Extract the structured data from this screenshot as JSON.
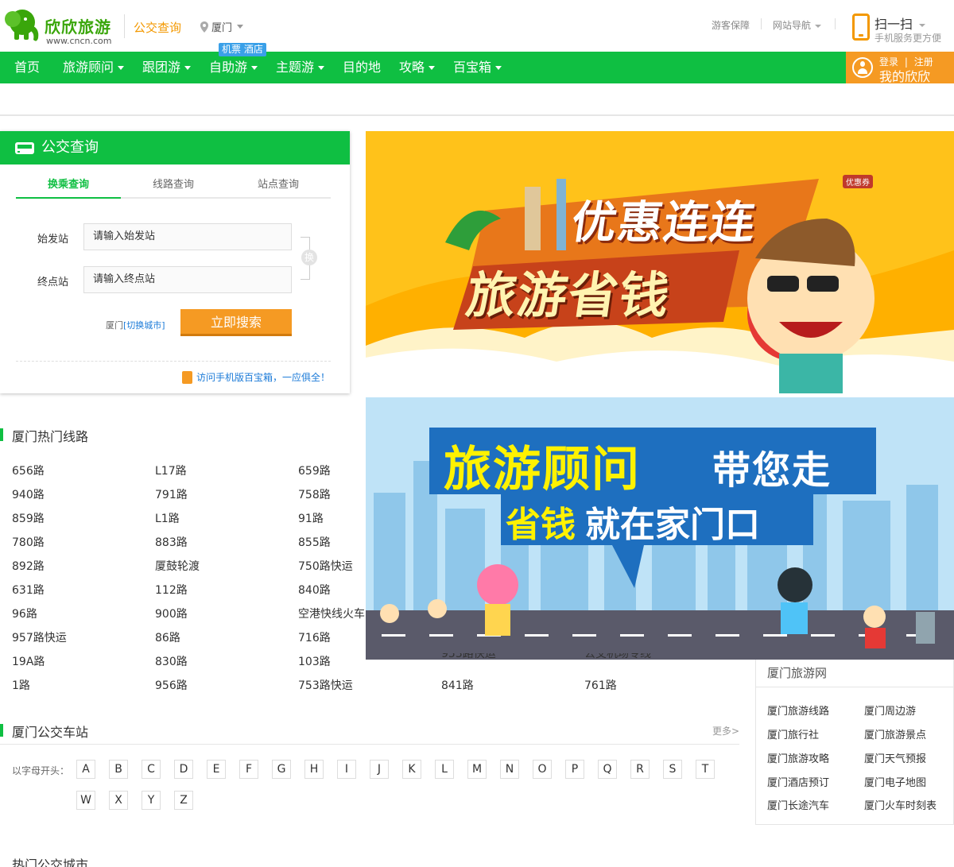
{
  "header": {
    "logo_text": "欣欣旅游",
    "logo_url": "www.cncn.com",
    "page_kind": "公交查询",
    "city": "厦门",
    "links": [
      "游客保障",
      "网站导航"
    ],
    "scan_title": "扫一扫",
    "scan_sub": "手机服务更方便"
  },
  "nav": {
    "items": [
      "首页",
      "旅游顾问",
      "跟团游",
      "自助游",
      "主题游",
      "目的地",
      "攻略",
      "百宝箱"
    ],
    "badge": "机票 酒店",
    "login": "登录",
    "register": "注册",
    "user_label": "我的欣欣"
  },
  "bus_panel": {
    "title": "公交查询",
    "tabs": [
      "换乘查询",
      "线路查询",
      "站点查询"
    ],
    "start_label": "始发站",
    "start_placeholder": "请输入始发站",
    "end_label": "终点站",
    "end_placeholder": "请输入终点站",
    "swap_label": "换",
    "city": "厦门",
    "switch_city": "[切换城市]",
    "search_button": "立即搜索",
    "mobile_note": "访问手机版百宝箱，一应俱全！"
  },
  "banner1": {
    "line1": "优惠连连",
    "line2": "旅游省钱",
    "tag": "优惠券"
  },
  "banner2": {
    "line1_a": "旅游顾问",
    "line1_b": "带您走",
    "line2_a": "省钱",
    "line2_b": "就在家门口"
  },
  "hot_routes": {
    "title": "厦门热门线路",
    "columns": [
      [
        "656路",
        "940路",
        "859路",
        "780路",
        "892路",
        "631路",
        "96路",
        "957路快运",
        "19A路",
        "1路"
      ],
      [
        "L17路",
        "791路",
        "L1路",
        "883路",
        "厦鼓轮渡",
        "112路",
        "900路",
        "86路",
        "830路",
        "956路"
      ],
      [
        "659路",
        "758路",
        "91路",
        "855路",
        "750路快运",
        "840路",
        "空港快线火车",
        "716路",
        "103路",
        "753路快运"
      ],
      [
        "953路快运",
        "841路"
      ],
      [
        "公交机场专线",
        "761路"
      ]
    ]
  },
  "stations": {
    "title": "厦门公交车站",
    "more": "更多>",
    "letters_label": "以字母开头：",
    "letters_row1": [
      "A",
      "B",
      "C",
      "D",
      "E",
      "F",
      "G",
      "H",
      "I",
      "J",
      "K",
      "L",
      "M",
      "N",
      "O",
      "P",
      "Q",
      "R",
      "S",
      "T"
    ],
    "letters_row2": [
      "W",
      "X",
      "Y",
      "Z"
    ]
  },
  "travel": {
    "title": "厦门旅游网",
    "links": [
      "厦门旅游线路",
      "厦门周边游",
      "厦门旅行社",
      "厦门旅游景点",
      "厦门旅游攻略",
      "厦门天气预报",
      "厦门酒店预订",
      "厦门电子地图",
      "厦门长途汽车",
      "厦门火车时刻表"
    ]
  },
  "hot_cities": {
    "title": "热门公交城市"
  },
  "colors": {
    "brand_green": "#0fbf42",
    "accent_orange": "#f59a23",
    "link_blue": "#1c7bd8"
  }
}
